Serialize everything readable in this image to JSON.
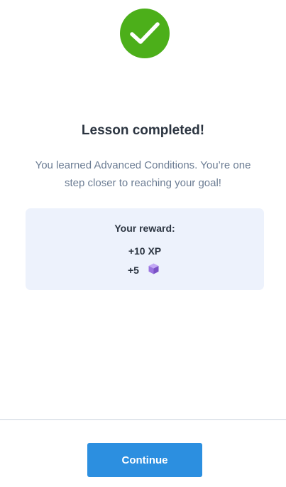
{
  "status_icon": "checkmark-circle-icon",
  "colors": {
    "success": "#4caf1a",
    "accent": "#2c8fe0",
    "reward_bg": "#edf2fc",
    "gem": "#8a63d2"
  },
  "lesson": {
    "title": "Lesson completed!",
    "message_line1": "You learned Advanced Conditions. You’re one",
    "message_line2": "step closer to reaching your goal!"
  },
  "reward": {
    "label": "Your reward:",
    "xp": "+10 XP",
    "bits": "+5",
    "bits_icon": "purple-cube-icon"
  },
  "footer": {
    "continue_label": "Continue"
  }
}
